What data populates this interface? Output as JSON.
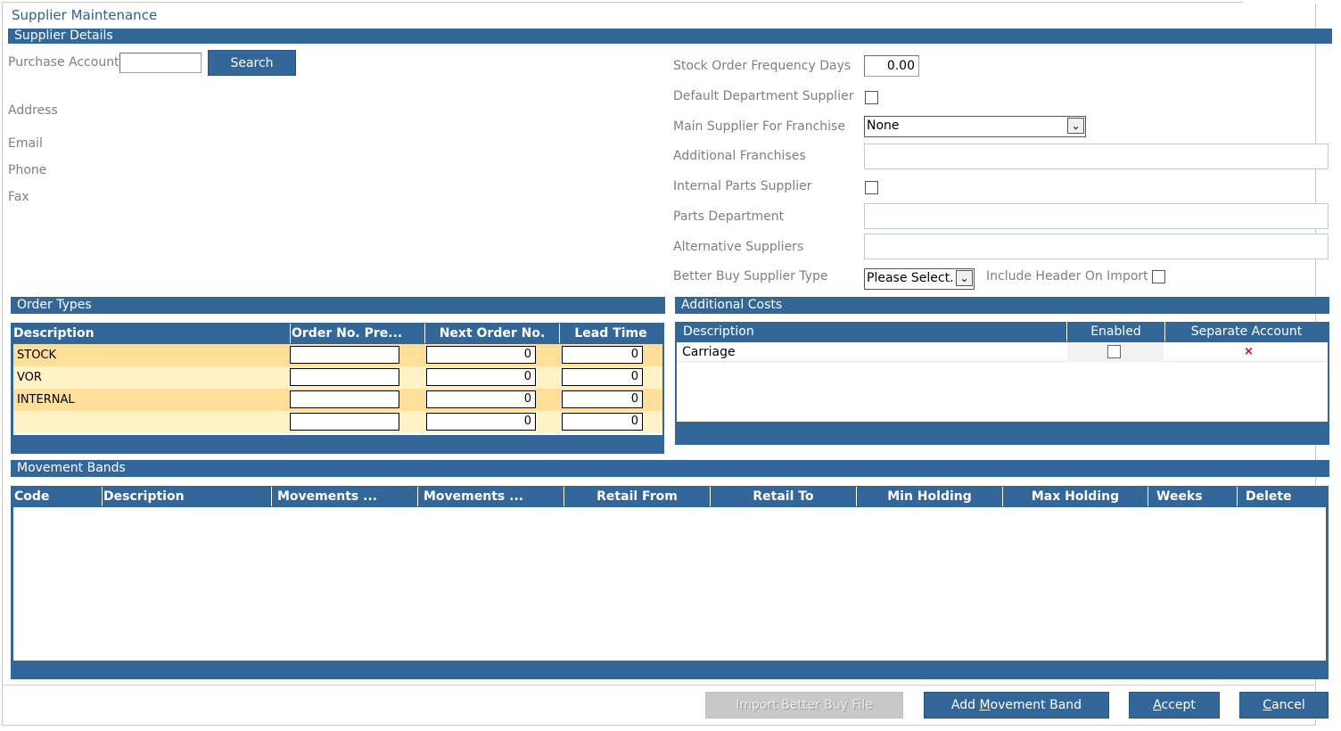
{
  "window": {
    "title": "Supplier Maintenance"
  },
  "supplier_details": {
    "header": "Supplier Details",
    "purchase_account_label": "Purchase Account",
    "purchase_account_value": "",
    "search_button": "Search",
    "address_label": "Address",
    "email_label": "Email",
    "phone_label": "Phone",
    "fax_label": "Fax"
  },
  "settings": {
    "stock_order_frequency_label": "Stock Order Frequency Days",
    "stock_order_frequency_value": "0.00",
    "default_department_supplier_label": "Default Department Supplier",
    "main_supplier_label": "Main Supplier For Franchise",
    "main_supplier_value": "None",
    "additional_franchises_label": "Additional Franchises",
    "internal_parts_supplier_label": "Internal Parts Supplier",
    "parts_department_label": "Parts Department",
    "alternative_suppliers_label": "Alternative Suppliers",
    "better_buy_supplier_type_label": "Better Buy Supplier Type",
    "better_buy_supplier_type_value": "Please Select.",
    "include_header_label": "Include Header On Import"
  },
  "order_types": {
    "header": "Order Types",
    "columns": [
      "Description",
      "Order No. Pre...",
      "Next Order No.",
      "Lead Time"
    ],
    "rows": [
      {
        "description": "STOCK",
        "prefix": "",
        "next_order": "0",
        "lead_time": "0"
      },
      {
        "description": "VOR",
        "prefix": "",
        "next_order": "0",
        "lead_time": "0"
      },
      {
        "description": "INTERNAL",
        "prefix": "",
        "next_order": "0",
        "lead_time": "0"
      },
      {
        "description": "",
        "prefix": "",
        "next_order": "0",
        "lead_time": "0"
      }
    ]
  },
  "additional_costs": {
    "header": "Additional Costs",
    "columns": [
      "Description",
      "Enabled",
      "Separate Account"
    ],
    "rows": [
      {
        "description": "Carriage",
        "separate_account_mark": "×"
      }
    ]
  },
  "movement_bands": {
    "header": "Movement Bands",
    "columns": [
      "Code",
      "Description",
      "Movements ...",
      "Movements ...",
      "Retail From",
      "Retail To",
      "Min Holding",
      "Max Holding",
      "Weeks",
      "Delete"
    ]
  },
  "footer": {
    "import_button": "Import Better Buy File",
    "add_band_pre": "Add ",
    "add_band_underline": "M",
    "add_band_post": "ovement Band",
    "accept_underline": "A",
    "accept_post": "ccept",
    "cancel_underline": "C",
    "cancel_post": "ancel"
  },
  "colors": {
    "accent": "#336699",
    "row_odd": "#ffdf99",
    "row_even": "#fff2c6",
    "title": "#2e5f96"
  }
}
